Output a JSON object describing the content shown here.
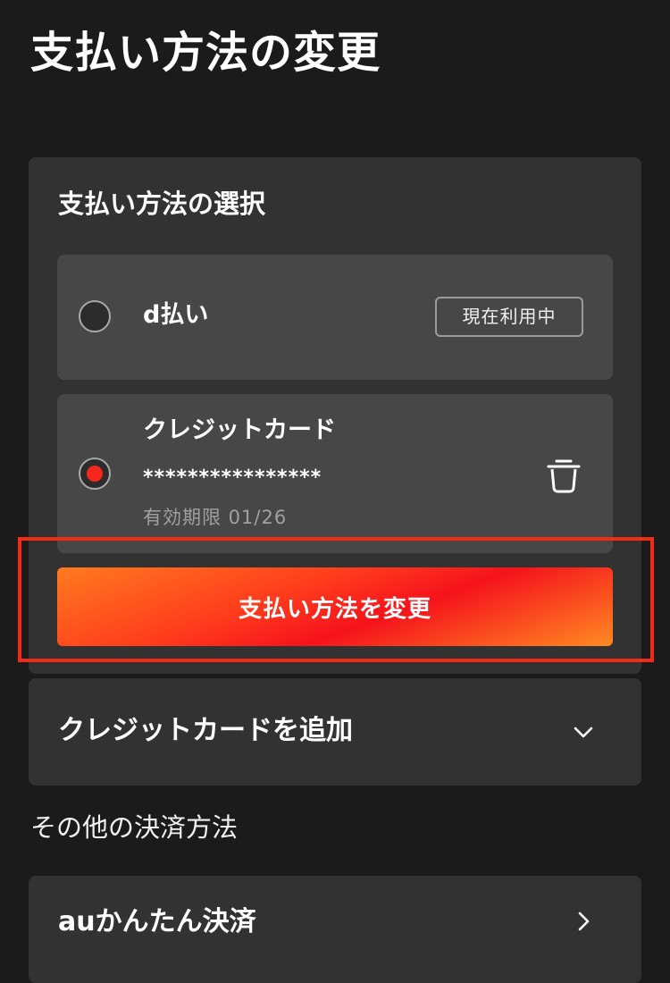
{
  "header": {
    "title": "支払い方法の変更"
  },
  "selection": {
    "title": "支払い方法の選択",
    "options": [
      {
        "label": "d払い",
        "badge": "現在利用中",
        "selected": false
      },
      {
        "label": "クレジットカード",
        "card_number": "****************",
        "expiry": "有効期限 01/26",
        "selected": true
      }
    ],
    "change_button": "支払い方法を変更"
  },
  "add_card": {
    "label": "クレジットカードを追加"
  },
  "other_methods": {
    "title": "その他の決済方法",
    "items": [
      {
        "label": "auかんたん決済"
      }
    ]
  },
  "icons": {
    "trash": "trash-icon",
    "chevron": "chevron-down-icon"
  },
  "colors": {
    "background": "#1b1b1b",
    "card": "#323232",
    "option": "#474747",
    "accent": "#f5261b",
    "highlight_border": "#f02b16"
  }
}
